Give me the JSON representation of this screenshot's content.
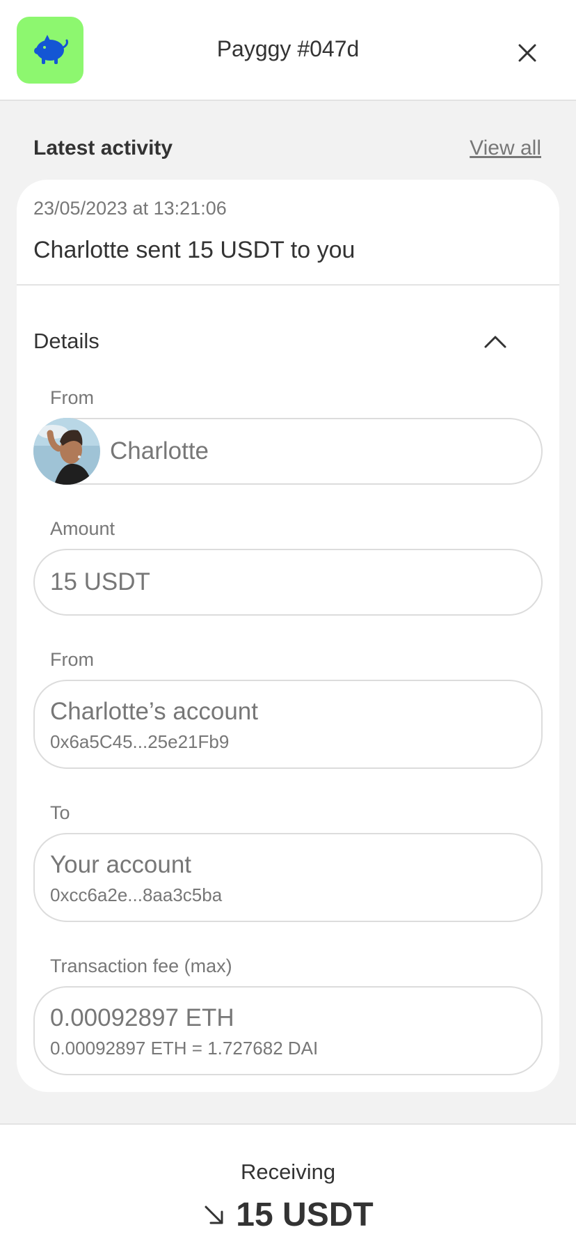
{
  "header": {
    "title": "Payggy #047d",
    "logo_icon": "piggy-bank-icon",
    "close_icon": "close-icon",
    "logo_bg": "#8df76f",
    "logo_fg": "#1456d4"
  },
  "activity": {
    "section_title": "Latest activity",
    "view_all_label": "View all",
    "date": "23/05/2023 at 13:21:06",
    "summary": "Charlotte sent 15 USDT to you",
    "details_label": "Details",
    "details_icon": "chevron-up-icon",
    "fields": {
      "from_user": {
        "label": "From",
        "value": "Charlotte"
      },
      "amount": {
        "label": "Amount",
        "value": "15 USDT"
      },
      "from_account": {
        "label": "From",
        "value": "Charlotte’s account",
        "sub": "0x6a5C45...25e21Fb9"
      },
      "to_account": {
        "label": "To",
        "value": "Your account",
        "sub": "0xcc6a2e...8aa3c5ba"
      },
      "fee": {
        "label": "Transaction fee (max)",
        "value": "0.00092897 ETH",
        "sub": "0.00092897 ETH = 1.727682 DAI"
      }
    }
  },
  "footer": {
    "receiving_label": "Receiving",
    "receiving_icon": "arrow-down-right-icon",
    "receiving_value": "15 USDT"
  }
}
